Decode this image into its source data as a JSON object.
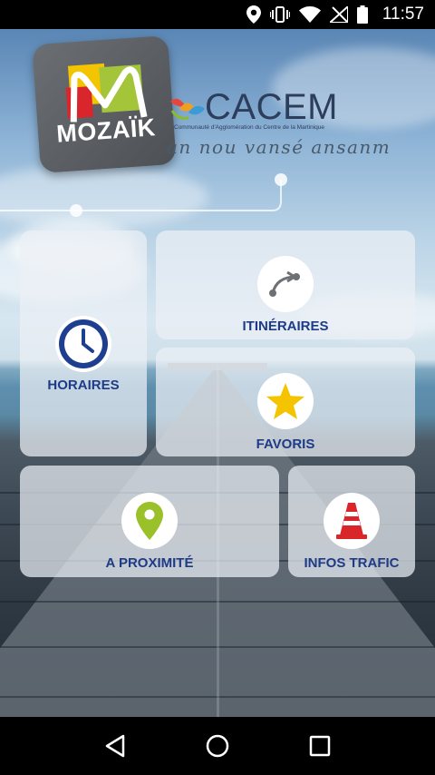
{
  "status_bar": {
    "time": "11:57",
    "icons": [
      "location-icon",
      "vibrate-icon",
      "wifi-icon",
      "no-signal-icon",
      "battery-icon"
    ]
  },
  "header": {
    "logo_text": "MOZAÏK",
    "brand_name": "CACEM",
    "brand_subtitle": "Communauté d'Agglomération du Centre de la Martinique",
    "tagline": "an nou vansé ansanm"
  },
  "tiles": {
    "horaires": {
      "label": "HORAIRES",
      "icon": "clock-icon"
    },
    "itineraires": {
      "label": "ITINÉRAIRES",
      "icon": "route-icon"
    },
    "favoris": {
      "label": "FAVORIS",
      "icon": "star-icon"
    },
    "proximite": {
      "label": "A PROXIMITÉ",
      "icon": "map-pin-icon"
    },
    "infos_trafic": {
      "label": "INFOS TRAFIC",
      "icon": "traffic-cone-icon"
    }
  },
  "nav_bar": {
    "buttons": [
      "back-icon",
      "home-icon",
      "recents-icon"
    ]
  },
  "colors": {
    "label": "#1d3b86",
    "clock": "#1e3f8f",
    "star": "#f5c400",
    "pin": "#9bc12a",
    "cone": "#d8262b",
    "route": "#6d7175"
  }
}
